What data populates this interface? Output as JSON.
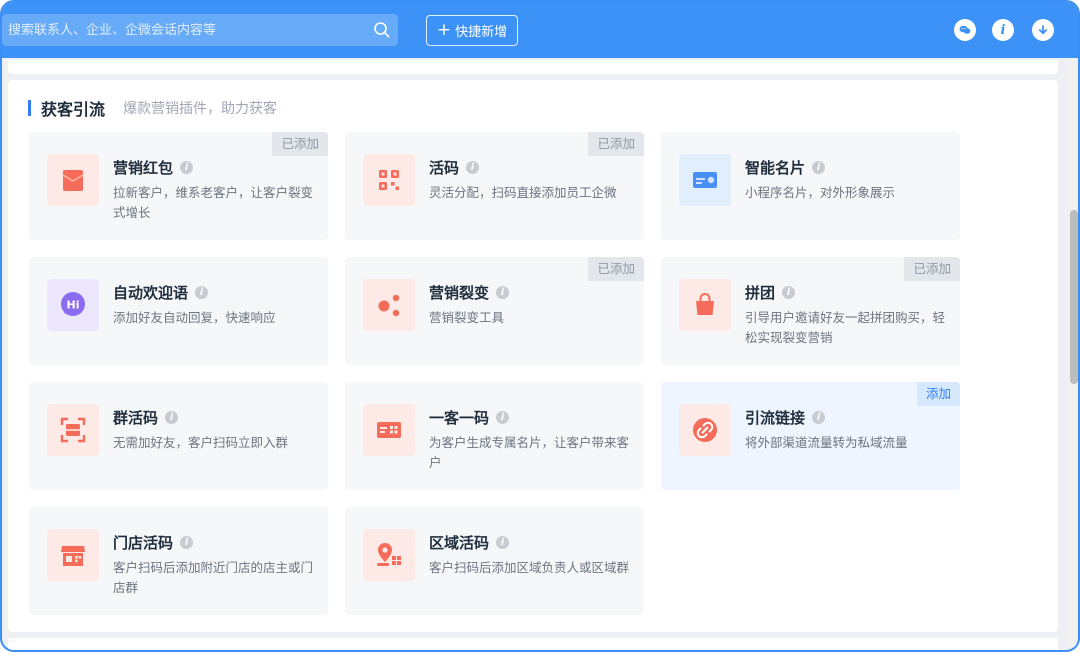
{
  "search": {
    "placeholder": "搜索联系人、企业、企微会话内容等"
  },
  "toolbar": {
    "quick_add_label": "快捷新增",
    "icons": [
      "wechat-icon",
      "info-icon",
      "download-icon"
    ]
  },
  "section": {
    "title": "获客引流",
    "subtitle": "爆款营销插件，助力获客"
  },
  "colors": {
    "accent": "#3d92f7",
    "icon_red": "#f56c5a",
    "icon_blue": "#4a8ff5",
    "icon_purple": "#8b6cf0"
  },
  "cards": [
    {
      "title": "营销红包",
      "desc": "拉新客户，维系老客户，让客户裂变式增长",
      "badge": "已添加",
      "icon": "red-envelope-icon"
    },
    {
      "title": "活码",
      "desc": "灵活分配，扫码直接添加员工企微",
      "badge": "已添加",
      "icon": "qr-code-icon"
    },
    {
      "title": "智能名片",
      "desc": "小程序名片，对外形象展示",
      "badge": "",
      "icon": "business-card-icon"
    },
    {
      "title": "自动欢迎语",
      "desc": "添加好友自动回复，快速响应",
      "badge": "",
      "icon": "hi-chat-icon"
    },
    {
      "title": "营销裂变",
      "desc": "营销裂变工具",
      "badge": "已添加",
      "icon": "fission-dots-icon"
    },
    {
      "title": "拼团",
      "desc": "引导用户邀请好友一起拼团购买，轻松实现裂变营销",
      "badge": "已添加",
      "icon": "shopping-bag-icon"
    },
    {
      "title": "群活码",
      "desc": "无需加好友，客户扫码立即入群",
      "badge": "",
      "icon": "scan-group-icon"
    },
    {
      "title": "一客一码",
      "desc": "为客户生成专属名片，让客户带来客户",
      "badge": "",
      "icon": "customer-code-icon"
    },
    {
      "title": "引流链接",
      "desc": "将外部渠道流量转为私域流量",
      "badge": "添加",
      "icon": "link-icon"
    },
    {
      "title": "门店活码",
      "desc": "客户扫码后添加附近门店的店主或门店群",
      "badge": "",
      "icon": "store-icon"
    },
    {
      "title": "区域活码",
      "desc": "客户扫码后添加区域负责人或区域群",
      "badge": "",
      "icon": "location-code-icon"
    }
  ]
}
